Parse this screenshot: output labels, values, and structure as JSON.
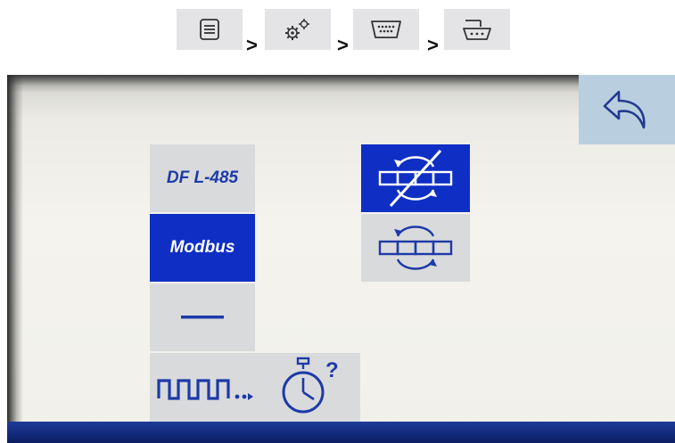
{
  "breadcrumb": {
    "items": [
      {
        "icon": "menu-list-icon"
      },
      {
        "icon": "gears-icon"
      },
      {
        "icon": "serial-port-icon"
      },
      {
        "icon": "serial-connector-icon"
      }
    ],
    "separator": ">"
  },
  "screen": {
    "back_icon": "back-arrow-icon",
    "protocol_options": [
      {
        "label": "DF L-485",
        "selected": false
      },
      {
        "label": "Modbus",
        "selected": true
      },
      {
        "label": "",
        "icon": "dash-icon",
        "selected": false
      }
    ],
    "mode_toggles": [
      {
        "icon": "no-data-exchange-icon",
        "selected": true
      },
      {
        "icon": "data-exchange-icon",
        "selected": false
      }
    ],
    "bottom_panel": {
      "pulse_icon": "pulse-train-icon",
      "timer_icon": "stopwatch-icon",
      "timer_mark": "?"
    },
    "colors": {
      "accent_blue": "#0f2fc4",
      "button_gray": "#d9dadc",
      "back_button": "#b9cfdf",
      "status_bar": "#0b1e63"
    }
  }
}
